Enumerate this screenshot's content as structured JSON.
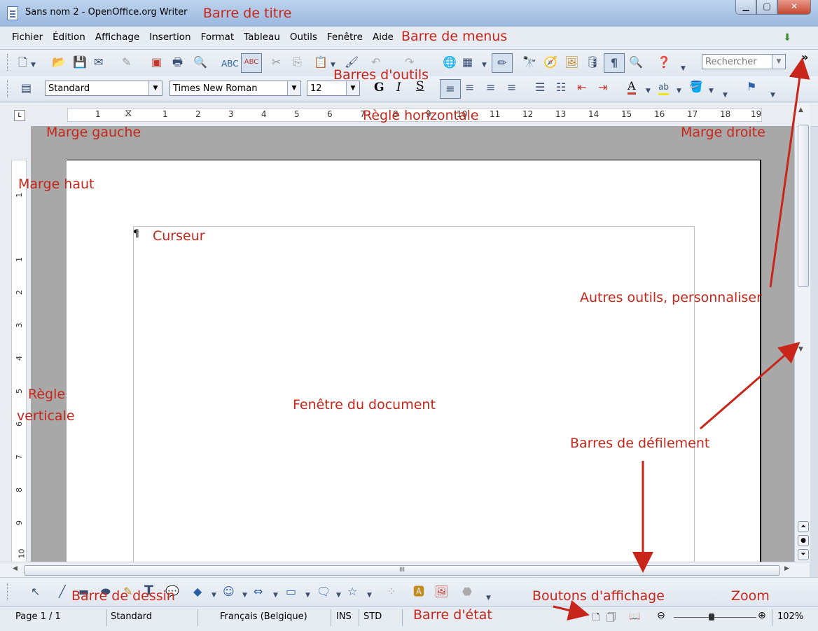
{
  "window": {
    "title": "Sans nom 2 - OpenOffice.org Writer",
    "btn_min": "▁",
    "btn_max": "▢",
    "btn_close": "✕"
  },
  "menu": [
    "Fichier",
    "Édition",
    "Affichage",
    "Insertion",
    "Format",
    "Tableau",
    "Outils",
    "Fenêtre",
    "Aide"
  ],
  "toolbar": {
    "search_placeholder": "Rechercher",
    "more": "»",
    "paragraph_style": "Standard",
    "font_name": "Times New Roman",
    "font_size": "12",
    "bold": "G",
    "italic": "I",
    "underline": "S"
  },
  "ruler": {
    "h_labels": [
      "1",
      "1",
      "2",
      "3",
      "4",
      "5",
      "6",
      "7",
      "8",
      "9",
      "10",
      "11",
      "12",
      "13",
      "14",
      "15",
      "16",
      "17",
      "18",
      "19"
    ],
    "v_labels": [
      "1",
      "1",
      "2",
      "3",
      "4",
      "5",
      "6",
      "7",
      "8",
      "9",
      "10"
    ],
    "corner": "L"
  },
  "scroll": {
    "hgrip": "III"
  },
  "status": {
    "page": "Page 1 / 1",
    "style": "Standard",
    "language": "Français (Belgique)",
    "insert_mode": "INS",
    "selection_mode": "STD",
    "zoom_minus": "⊖",
    "zoom_plus": "⊕",
    "zoom": "102%"
  },
  "annotations": {
    "title_bar": "Barre de titre",
    "menu_bar": "Barre de menus",
    "toolbars": "Barres d'outils",
    "h_ruler": "Règle horizontale",
    "left_margin": "Marge gauche",
    "right_margin": "Marge droite",
    "top_margin": "Marge haut",
    "cursor": "Curseur",
    "more_tools": "Autres outils, personnaliser",
    "v_ruler_1": "Règle",
    "v_ruler_2": "verticale",
    "doc_window": "Fenêtre du document",
    "scrollbars": "Barres de  défilement",
    "drawing_bar": "Barre de dessin",
    "view_buttons": "Boutons d'affichage",
    "zoom": "Zoom",
    "status_bar": "Barre d'état"
  },
  "colors": {
    "annotation": "#c8261a",
    "page": "#ffffff",
    "canvas": "#a8a8a8"
  }
}
